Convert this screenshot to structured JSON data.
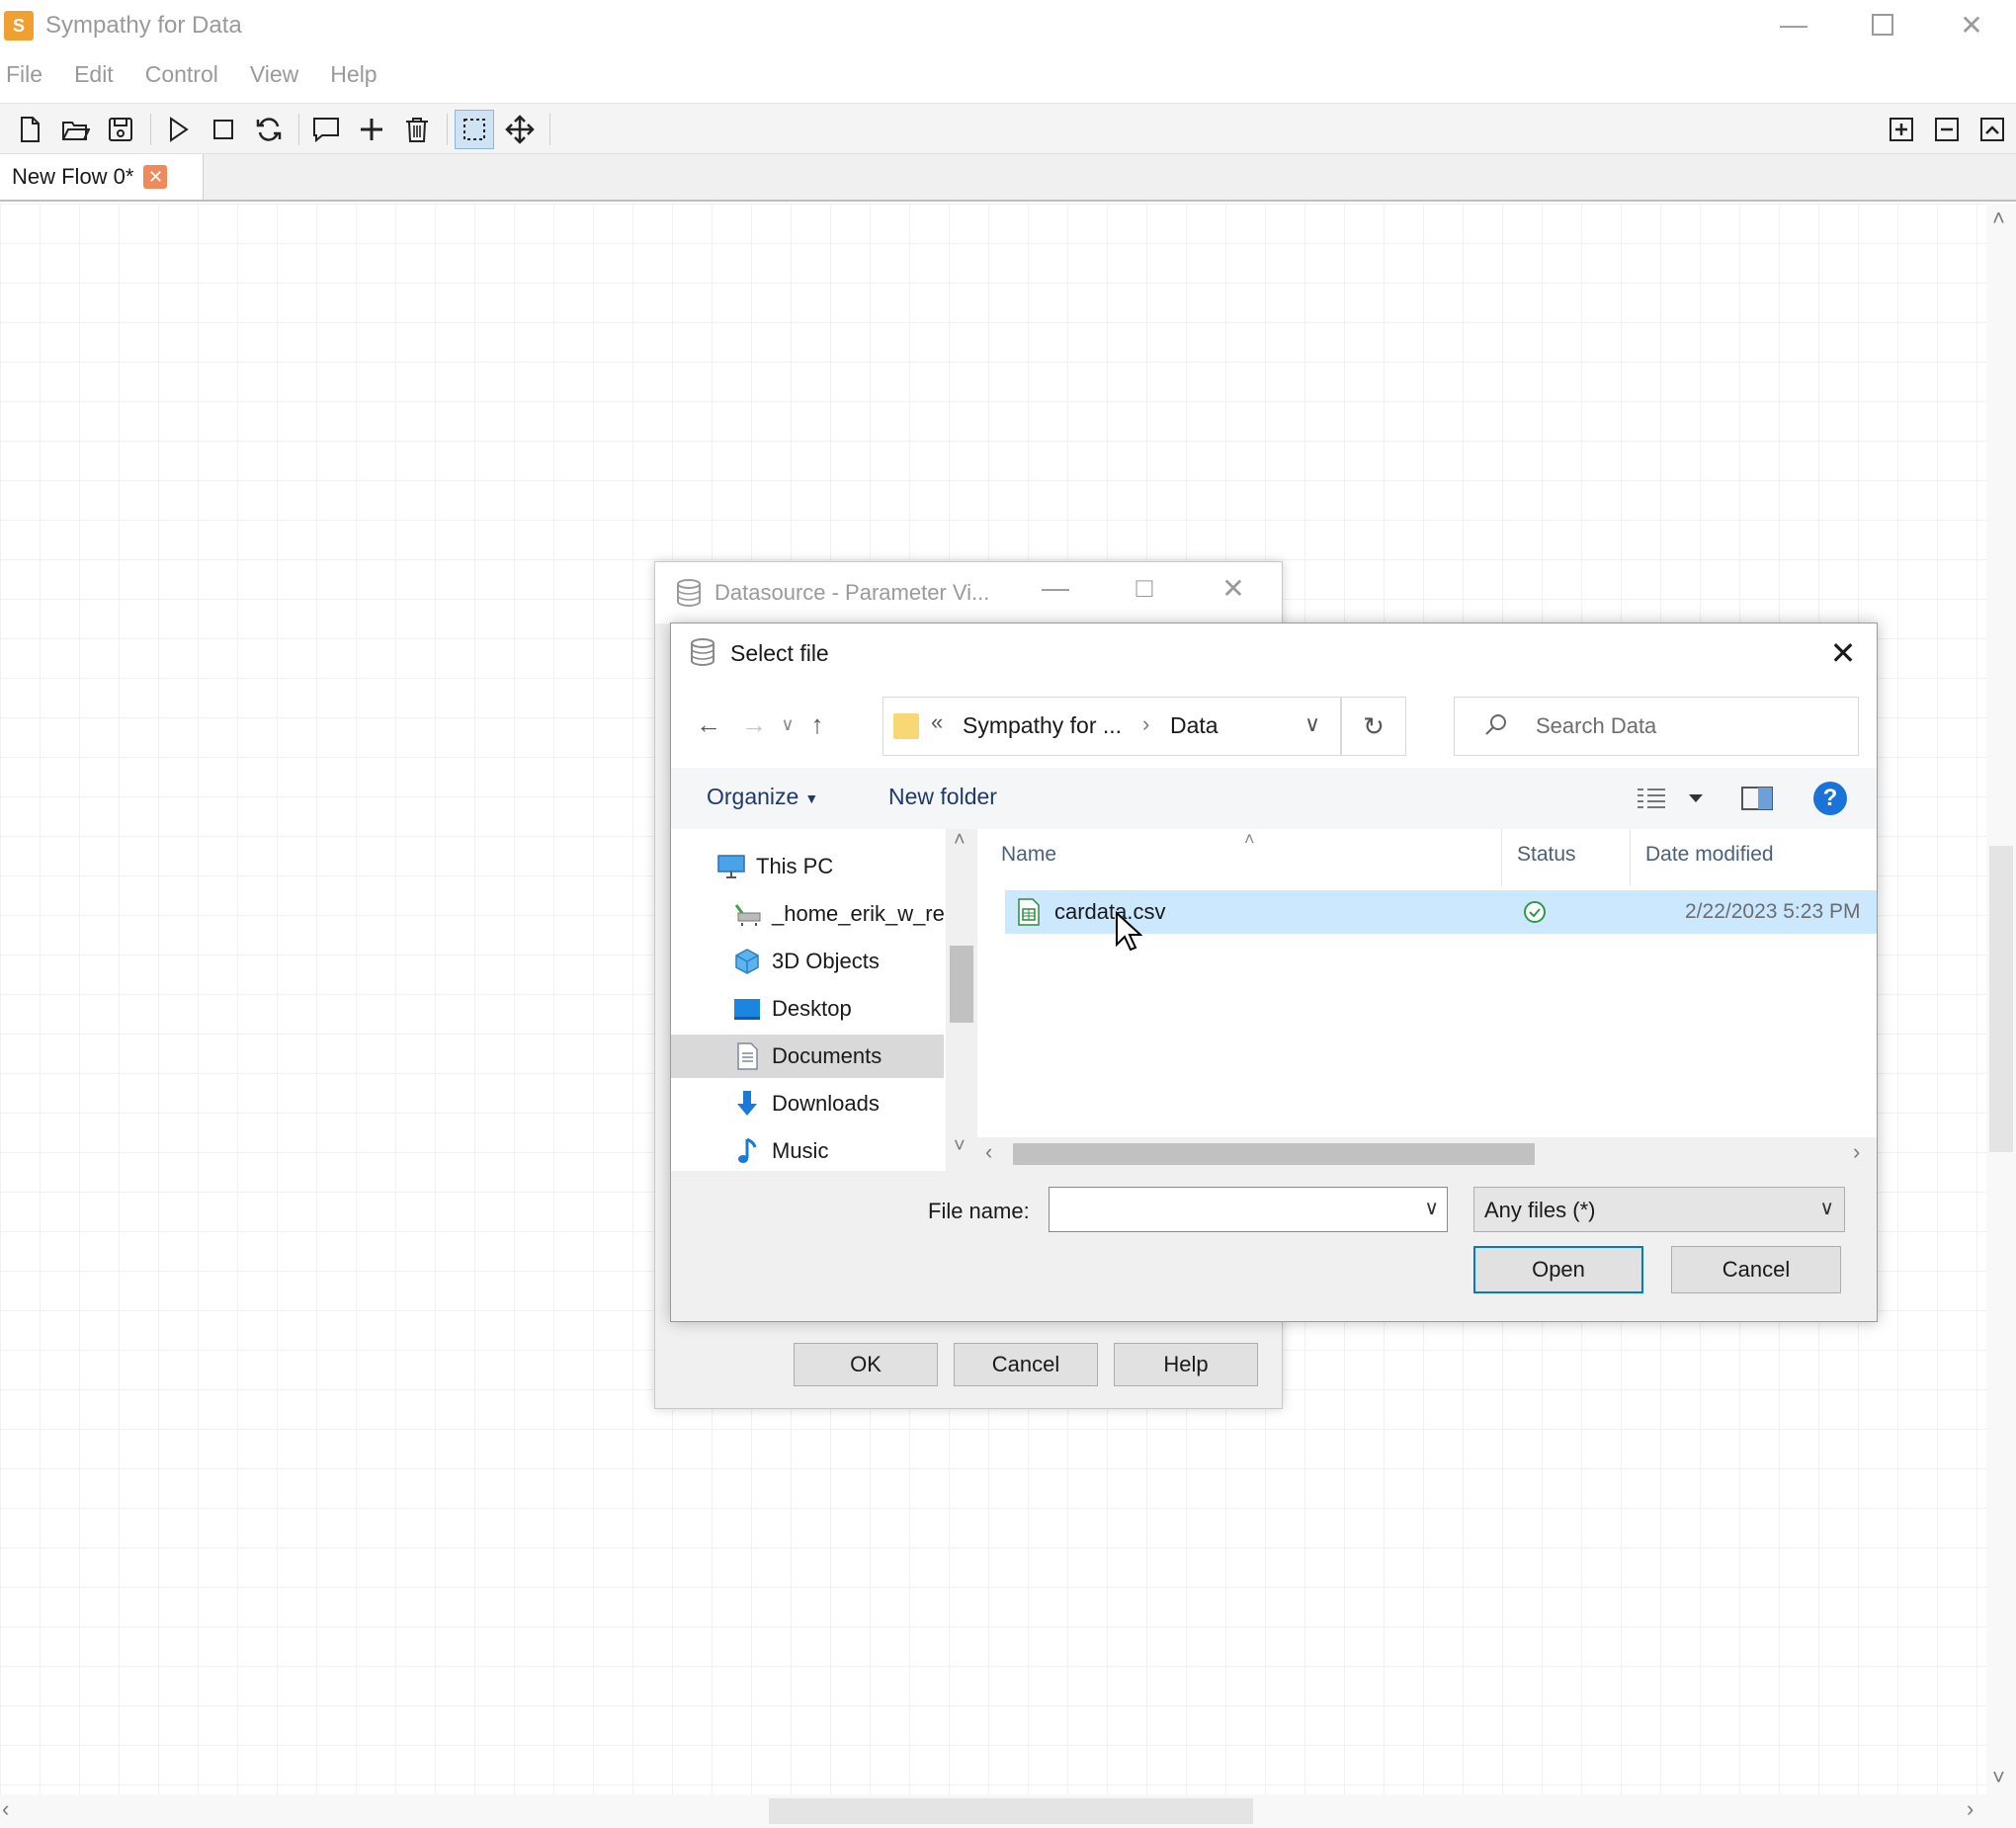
{
  "app": {
    "title": "Sympathy for Data",
    "icon": "sympathy-logo-icon"
  },
  "menu": [
    "File",
    "Edit",
    "Control",
    "View",
    "Help"
  ],
  "toolbar": {
    "icons": [
      "new-file-icon",
      "open-folder-icon",
      "save-icon",
      "run-icon",
      "stop-icon",
      "reload-icon",
      "comment-icon",
      "add-icon",
      "delete-icon",
      "select-icon",
      "move-icon",
      "zoom-in-icon",
      "zoom-out-icon",
      "fit-icon"
    ]
  },
  "tabs": [
    {
      "label": "New Flow 0*"
    }
  ],
  "datasource_dialog": {
    "title": "Datasource - Parameter Vi...",
    "buttons": {
      "ok": "OK",
      "cancel": "Cancel",
      "help": "Help"
    }
  },
  "select_file": {
    "title": "Select file",
    "address": {
      "overflow": "«",
      "crumb1": "Sympathy for ...",
      "separator": "›",
      "crumb2": "Data"
    },
    "search_placeholder": "Search Data",
    "commands": {
      "organize": "Organize",
      "new_folder": "New folder"
    },
    "tree": [
      {
        "label": "This PC",
        "icon": "computer-icon"
      },
      {
        "label": "_home_erik_w_re",
        "icon": "network-drive-icon"
      },
      {
        "label": "3D Objects",
        "icon": "cube-icon"
      },
      {
        "label": "Desktop",
        "icon": "desktop-icon"
      },
      {
        "label": "Documents",
        "icon": "documents-icon",
        "selected": true
      },
      {
        "label": "Downloads",
        "icon": "download-arrow-icon"
      },
      {
        "label": "Music",
        "icon": "music-note-icon"
      }
    ],
    "columns": {
      "name": "Name",
      "status": "Status",
      "date": "Date modified"
    },
    "files": [
      {
        "name": "cardata.csv",
        "status": "synced",
        "date": "2/22/2023 5:23 PM"
      }
    ],
    "file_name_label": "File name:",
    "file_name_value": "",
    "file_type": "Any files (*)",
    "buttons": {
      "open": "Open",
      "cancel": "Cancel"
    }
  },
  "colors": {
    "accent": "#0078d7",
    "selection": "#cce8ff",
    "status_ok": "#2e9a4a"
  }
}
